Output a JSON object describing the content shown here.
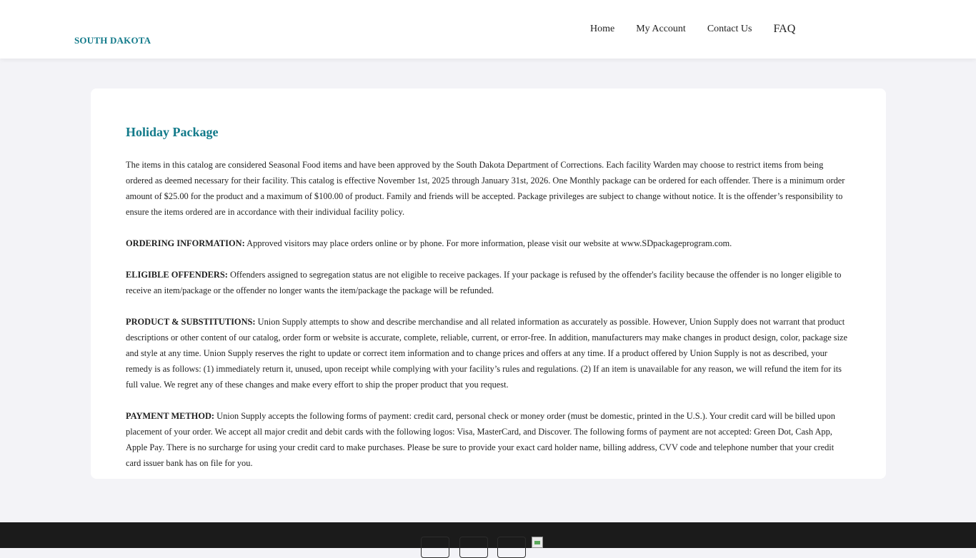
{
  "header": {
    "brand": "SOUTH DAKOTA",
    "nav": [
      {
        "label": "Home"
      },
      {
        "label": "My Account"
      },
      {
        "label": "Contact Us"
      },
      {
        "label": "FAQ"
      }
    ]
  },
  "main": {
    "title": "Holiday Package",
    "intro": "The items in this catalog are considered Seasonal Food items and have been approved by the South Dakota Department of Corrections. Each facility Warden may choose to restrict items from being ordered as deemed necessary for their facility. This catalog is effective November 1st, 2025 through January 31st, 2026. One Monthly package can be ordered for each offender. There is a minimum order amount of $25.00 for the product and a maximum of $100.00 of product. Family and friends will be accepted. Package privileges are subject to change without notice. It is the offender’s responsibility to ensure the items ordered are in accordance with their individual facility policy.",
    "sections": [
      {
        "heading": "ORDERING INFORMATION:",
        "text": "Approved visitors may place orders online or by phone. For more information, please visit our website at www.SDpackageprogram.com."
      },
      {
        "heading": "ELIGIBLE OFFENDERS:",
        "text": "Offenders assigned to segregation status are not eligible to receive packages. If your package is refused by the offender's facility because the offender is no longer eligible to receive an item/package or the offender no longer wants the item/package the package will be refunded."
      },
      {
        "heading": "PRODUCT & SUBSTITUTIONS:",
        "text": "Union Supply attempts to show and describe merchandise and all related information as accurately as possible. However, Union Supply does not warrant that product descriptions or other content of our catalog, order form or website is accurate, complete, reliable, current, or error-free. In addition, manufacturers may make changes in product design, color, package size and style at any time. Union Supply reserves the right to update or correct item information and to change prices and offers at any time. If a product offered by Union Supply is not as described, your remedy is as follows: (1) immediately return it, unused, upon receipt while complying with your facility’s rules and regulations. (2) If an item is unavailable for any reason, we will refund the item for its full value. We regret any of these changes and make every effort to ship the proper product that you request."
      },
      {
        "heading": "PAYMENT METHOD:",
        "text": "Union Supply accepts the following forms of payment: credit card, personal check or money order (must be domestic, printed in the U.S.). Your credit card will be billed upon placement of your order. We accept all major credit and debit cards with the following logos: Visa, MasterCard, and Discover. The following forms of payment are not accepted: Green Dot, Cash App, Apple Pay. There is no surcharge for using your credit card to make purchases. Please be sure to provide your exact card holder name, billing address, CVV code and telephone number that your credit card issuer bank has on file for you."
      }
    ]
  },
  "footer": {
    "social_icons": [
      "social-icon",
      "social-icon",
      "social-icon",
      "broken-image-icon"
    ],
    "background": "#1b1b1b"
  },
  "colors": {
    "accent": "#127a8a",
    "page_bg": "#f3f3f7",
    "card_bg": "#ffffff"
  }
}
